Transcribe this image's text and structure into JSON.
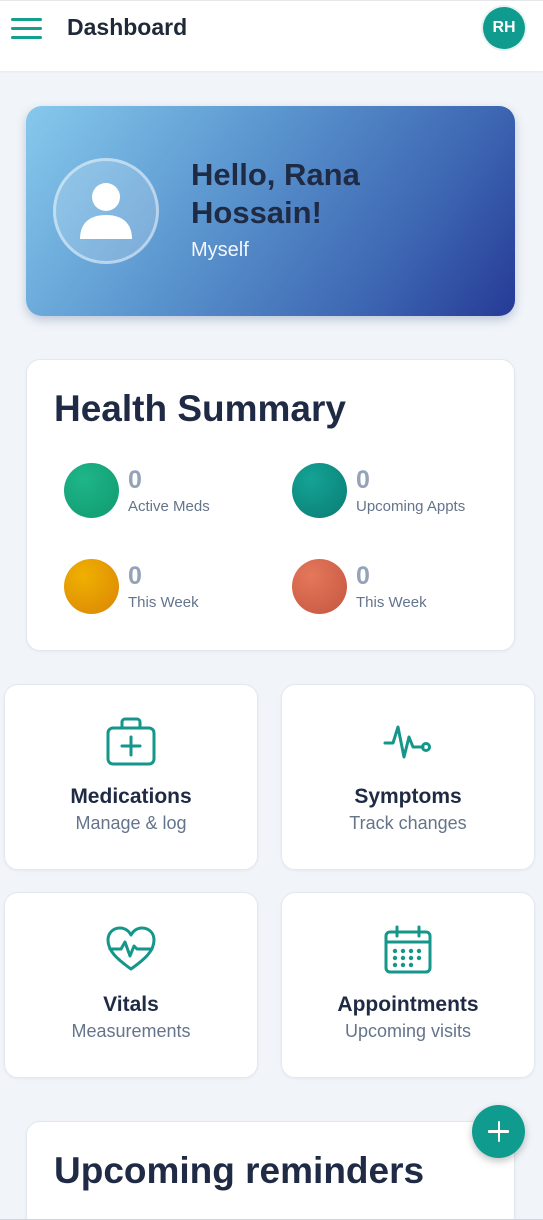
{
  "header": {
    "title": "Dashboard",
    "user_initials": "RH",
    "menu_icon": "hamburger-menu-icon"
  },
  "profile": {
    "greeting": "Hello, Rana Hossain!",
    "relation": "Myself",
    "avatar_icon": "user-icon"
  },
  "health_summary": {
    "title": "Health Summary",
    "stats": [
      {
        "value": "0",
        "label": "Active Meds",
        "color": "#16a37a"
      },
      {
        "value": "0",
        "label": "Upcoming Appts",
        "color": "#0e8f86"
      },
      {
        "value": "0",
        "label": "This Week",
        "color": "#e39a06"
      },
      {
        "value": "0",
        "label": "This Week",
        "color": "#d7654a"
      }
    ]
  },
  "features": [
    {
      "title": "Medications",
      "subtitle": "Manage & log",
      "icon": "first-aid-kit-icon"
    },
    {
      "title": "Symptoms",
      "subtitle": "Track changes",
      "icon": "pulse-stethoscope-icon"
    },
    {
      "title": "Vitals",
      "subtitle": "Measurements",
      "icon": "heartbeat-icon"
    },
    {
      "title": "Appointments",
      "subtitle": "Upcoming visits",
      "icon": "calendar-icon"
    }
  ],
  "reminders": {
    "title": "Upcoming reminders"
  },
  "fab": {
    "icon": "plus-icon"
  },
  "colors": {
    "accent": "#0f9b8e",
    "icon_teal": "#14968a"
  }
}
